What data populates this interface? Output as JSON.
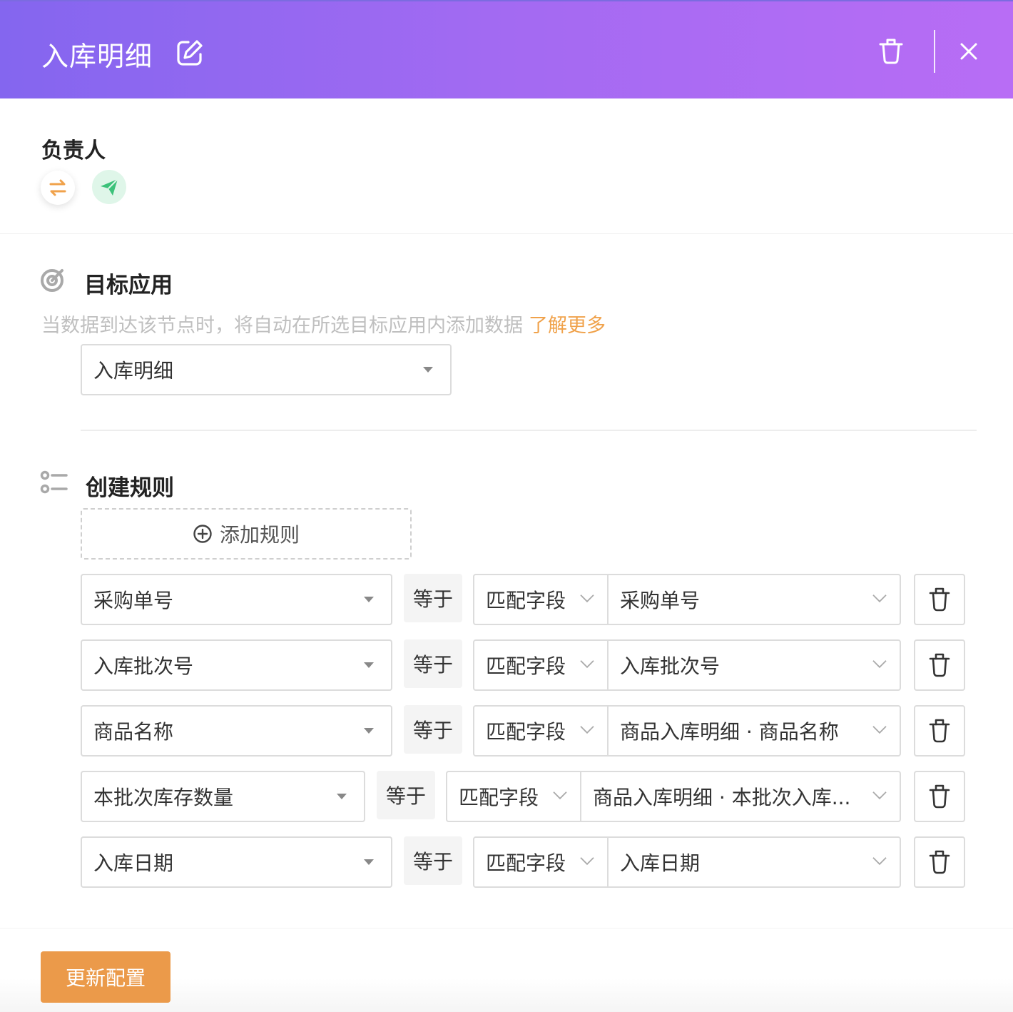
{
  "header": {
    "title": "入库明细",
    "icons": {
      "edit": "edit-icon",
      "delete": "trash-icon",
      "close": "close-icon"
    }
  },
  "owner": {
    "label": "负责人",
    "actions": [
      {
        "icon": "swap-icon",
        "color": "#f0a24b"
      },
      {
        "icon": "send-icon",
        "color": "#3cc27a"
      }
    ]
  },
  "target_app": {
    "title": "目标应用",
    "icon": "target-icon",
    "description": "当数据到达该节点时，将自动在所选目标应用内添加数据",
    "learn_more": "了解更多",
    "selected_app": "入库明细"
  },
  "rules": {
    "title": "创建规则",
    "icon": "list-icon",
    "add_label": "添加规则",
    "items": [
      {
        "field": "采购单号",
        "op": "等于",
        "type": "匹配字段",
        "value": "采购单号"
      },
      {
        "field": "入库批次号",
        "op": "等于",
        "type": "匹配字段",
        "value": "入库批次号"
      },
      {
        "field": "商品名称",
        "op": "等于",
        "type": "匹配字段",
        "value": "商品入库明细 · 商品名称"
      },
      {
        "field": "本批次库存数量",
        "op": "等于",
        "type": "匹配字段",
        "value": "商品入库明细 · 本批次入库..."
      },
      {
        "field": "入库日期",
        "op": "等于",
        "type": "匹配字段",
        "value": "入库日期"
      }
    ]
  },
  "footer": {
    "update_label": "更新配置"
  },
  "colors": {
    "accent": "#eb9a4a",
    "header_start": "#8466ef",
    "header_end": "#b86df5",
    "link": "#f0a24b"
  }
}
